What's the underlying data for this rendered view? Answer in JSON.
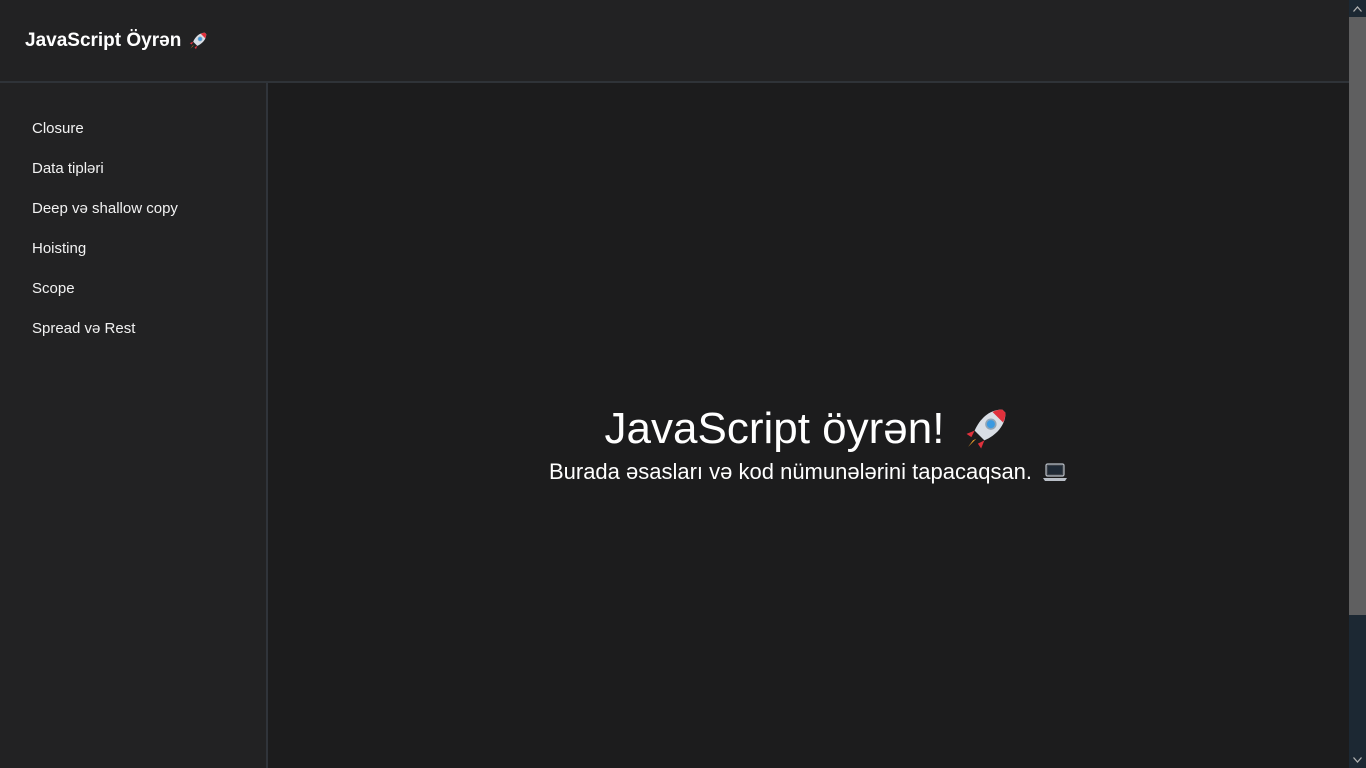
{
  "header": {
    "brand": "JavaScript Öyrən",
    "brand_icon": "rocket-icon"
  },
  "sidebar": {
    "items": [
      {
        "label": "Closure"
      },
      {
        "label": "Data tipləri"
      },
      {
        "label": "Deep və shallow copy"
      },
      {
        "label": "Hoisting"
      },
      {
        "label": "Scope"
      },
      {
        "label": "Spread və Rest"
      }
    ]
  },
  "hero": {
    "title": "JavaScript öyrən!",
    "title_icon": "rocket-icon",
    "subtitle": "Burada əsasları və kod nümunələrini tapacaqsan.",
    "subtitle_icon": "laptop-icon"
  },
  "colors": {
    "background": "#1c1c1d",
    "panel": "#222223",
    "border": "#30343a",
    "text": "#ffffff"
  }
}
